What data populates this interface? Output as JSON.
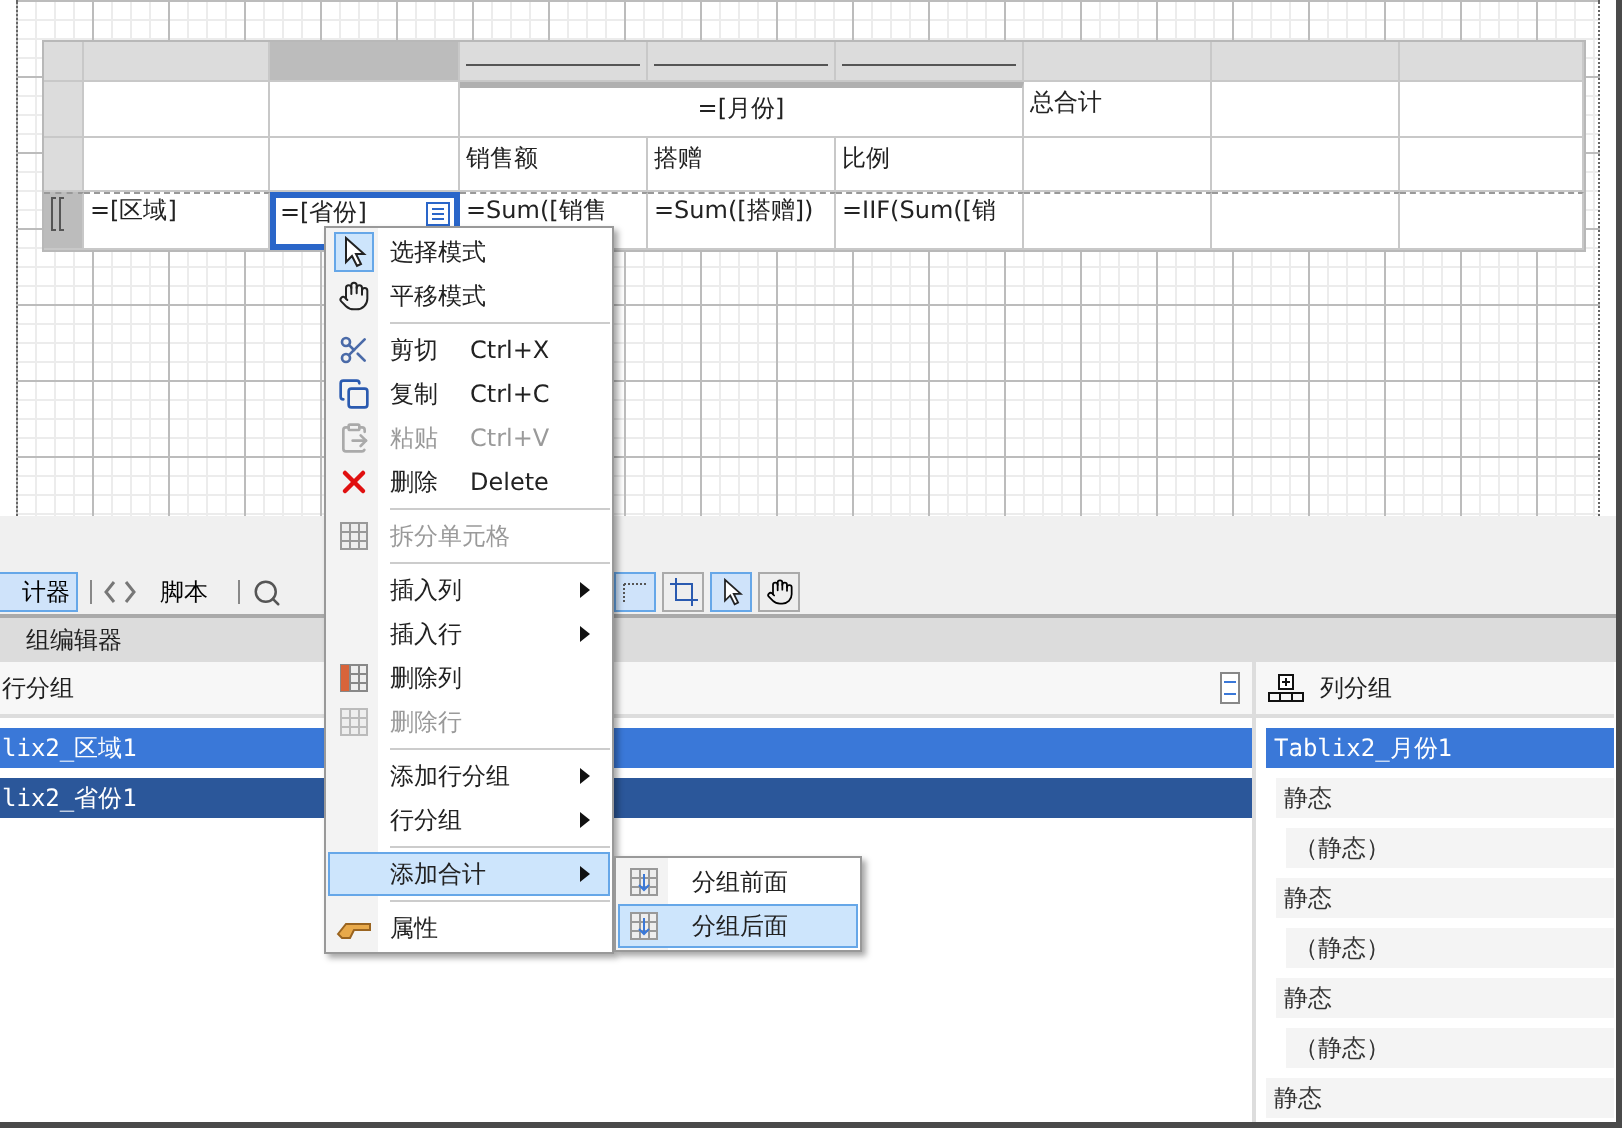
{
  "report_table": {
    "column_group_header": "=[月份]",
    "total_header": "总合计",
    "measure_headers": [
      "销售额",
      "搭赠",
      "比例"
    ],
    "detail_cells": [
      {
        "text": "=[区域]",
        "selected": false
      },
      {
        "text": "=[省份]",
        "selected": true
      },
      {
        "text": "=Sum([销售",
        "selected": false
      },
      {
        "text": "=Sum([搭赠])",
        "selected": false
      },
      {
        "text": "=IIF(Sum([销",
        "selected": false
      }
    ]
  },
  "toolbar": {
    "tabs": [
      {
        "label": "计器",
        "selected": true
      },
      {
        "label": "脚本",
        "selected": false
      }
    ],
    "tools": [
      {
        "selected": true
      },
      {
        "selected": false
      },
      {
        "selected": true
      },
      {
        "selected": false
      }
    ]
  },
  "group_editor": {
    "title": "组编辑器",
    "row_groups": {
      "title": "行分组",
      "items": [
        {
          "text": "lix2_区域1",
          "selected": true,
          "focused": false
        },
        {
          "text": "lix2_省份1",
          "selected": true,
          "focused": true
        }
      ]
    },
    "column_groups": {
      "title": "列分组",
      "items": [
        {
          "text": "Tablix2_月份1",
          "selected": true,
          "children": [
            {
              "text": "静态",
              "selected": false,
              "children": [
                {
                  "text": "（静态）",
                  "selected": false
                }
              ]
            },
            {
              "text": "静态",
              "selected": false,
              "children": [
                {
                  "text": "（静态）",
                  "selected": false
                }
              ]
            },
            {
              "text": "静态",
              "selected": false,
              "children": [
                {
                  "text": "（静态）",
                  "selected": false
                }
              ]
            }
          ]
        },
        {
          "text": "静态",
          "selected": false
        }
      ]
    }
  },
  "context_menu": {
    "items": [
      {
        "kind": "item",
        "label": "选择模式",
        "checked": true
      },
      {
        "kind": "item",
        "label": "平移模式",
        "checked": false
      },
      {
        "kind": "separator"
      },
      {
        "kind": "item",
        "label": "剪切",
        "shortcut": "Ctrl+X"
      },
      {
        "kind": "item",
        "label": "复制",
        "shortcut": "Ctrl+C"
      },
      {
        "kind": "item",
        "label": "粘贴",
        "shortcut": "Ctrl+V",
        "disabled": true
      },
      {
        "kind": "item",
        "label": "删除",
        "shortcut": "Delete"
      },
      {
        "kind": "separator"
      },
      {
        "kind": "item",
        "label": "拆分单元格",
        "disabled": true
      },
      {
        "kind": "separator"
      },
      {
        "kind": "item",
        "label": "插入列",
        "submenu": true
      },
      {
        "kind": "item",
        "label": "插入行",
        "submenu": true
      },
      {
        "kind": "item",
        "label": "删除列"
      },
      {
        "kind": "item",
        "label": "删除行",
        "disabled": true
      },
      {
        "kind": "separator"
      },
      {
        "kind": "item",
        "label": "添加行分组",
        "submenu": true
      },
      {
        "kind": "item",
        "label": "行分组",
        "submenu": true
      },
      {
        "kind": "separator"
      },
      {
        "kind": "item",
        "label": "添加合计",
        "submenu": true,
        "highlighted": true
      },
      {
        "kind": "separator"
      },
      {
        "kind": "item",
        "label": "属性"
      }
    ],
    "submenu": {
      "items": [
        {
          "label": "分组前面",
          "highlighted": false
        },
        {
          "label": "分组后面",
          "highlighted": true
        }
      ]
    }
  }
}
